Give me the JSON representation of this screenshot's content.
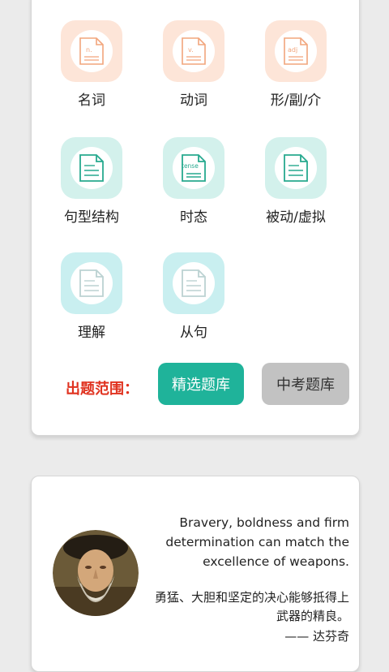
{
  "word_categories": [
    {
      "label": "名词",
      "icon_text": "n.",
      "icon": "document-n-icon",
      "color": "peach"
    },
    {
      "label": "动词",
      "icon_text": "v.",
      "icon": "document-v-icon",
      "color": "peach"
    },
    {
      "label": "形/副/介",
      "icon_text": "adj",
      "icon": "document-adj-icon",
      "color": "peach"
    },
    {
      "label": "句型结构",
      "icon": "document-lines-icon",
      "color": "mint"
    },
    {
      "label": "时态",
      "icon_text": "tense",
      "icon": "document-tense-icon",
      "color": "mint"
    },
    {
      "label": "被动/虚拟",
      "icon": "document-lines-icon",
      "color": "mint"
    },
    {
      "label": "理解",
      "icon": "document-lines-icon",
      "color": "aqua"
    },
    {
      "label": "从句",
      "icon": "document-lines-icon",
      "color": "aqua"
    }
  ],
  "range": {
    "label": "出题范围：",
    "selected_button": "精选题库",
    "other_button": "中考题库"
  },
  "quote": {
    "english": "Bravery, boldness and firm determination can match the excellence of weapons.",
    "chinese": "勇猛、大胆和坚定的决心能够抵得上武器的精良。",
    "author": "—— 达芬奇",
    "portrait": "portrait-illustration"
  },
  "colors": {
    "peach_tile": "#fde5d8",
    "peach_stroke": "#f2a57c",
    "mint_tile": "#d3f1ec",
    "mint_stroke": "#27a98f",
    "aqua_tile": "#c9eff0",
    "aqua_stroke": "#bcd2d2",
    "accent_green": "#1fb39a",
    "range_red": "#e0321f"
  }
}
